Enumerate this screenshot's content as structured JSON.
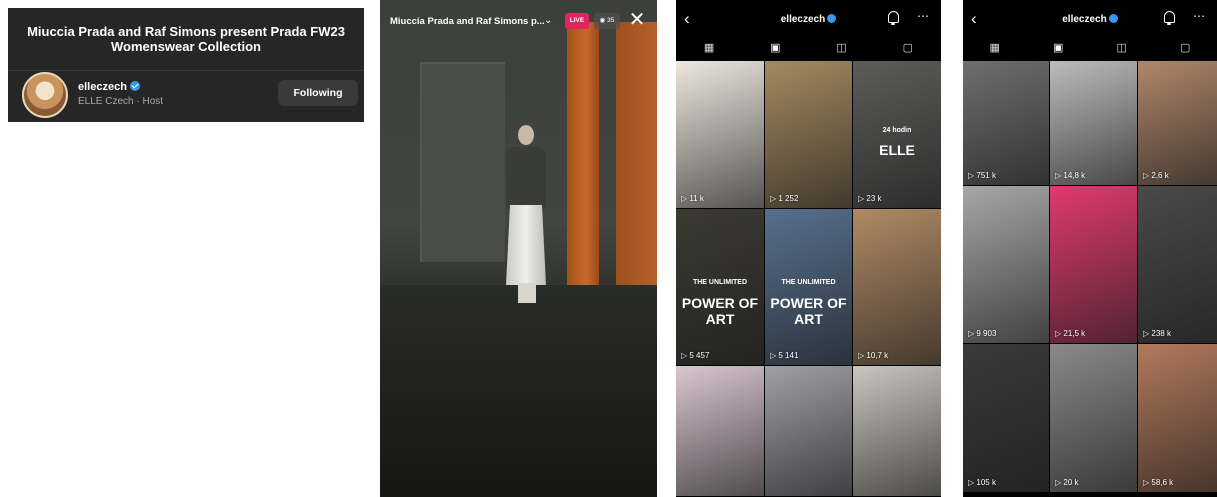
{
  "live_card": {
    "title": "Miuccia Prada and Raf Simons present Prada FW23 Womenswear Collection",
    "host_name": "elleczech",
    "host_sub": "ELLE Czech · Host",
    "follow_label": "Following"
  },
  "live_video": {
    "title": "Miuccia Prada and Raf Simons p...",
    "badge": "LIVE",
    "viewers": "35",
    "close_icon": "close-icon"
  },
  "profile_a": {
    "username": "elleczech",
    "tiles": [
      {
        "views": "11 k",
        "bg": "#ede7de"
      },
      {
        "views": "1 252",
        "bg": "#a58a5f"
      },
      {
        "views": "23 k",
        "bg": "#5c5d5a",
        "overlay_top": "24 hodin",
        "overlay_bottom": "ELLE"
      },
      {
        "views": "5 457",
        "bg": "#3b3a33",
        "overlay_top": "THE UNLIMITED",
        "overlay_bottom": "POWER OF ART"
      },
      {
        "views": "5 141",
        "bg": "#57708e",
        "overlay_top": "THE UNLIMITED",
        "overlay_bottom": "POWER OF ART"
      },
      {
        "views": "10,7 k",
        "bg": "#b08a64"
      },
      {
        "views": "",
        "bg": "#d9c6cf"
      },
      {
        "views": "",
        "bg": "#9f9fa6"
      },
      {
        "views": "",
        "bg": "#c9c6c0"
      }
    ]
  },
  "profile_b": {
    "username": "elleczech",
    "tiles": [
      {
        "views": "751 k",
        "bg": "#6f6f6f"
      },
      {
        "views": "14,8 k",
        "bg": "#bcbcbc"
      },
      {
        "views": "2,6 k",
        "bg": "#b0876a"
      },
      {
        "views": "9 903",
        "bg": "#a7a7a7"
      },
      {
        "views": "21,5 k",
        "bg": "#e03a6f"
      },
      {
        "views": "238 k",
        "bg": "#4a4a4a"
      },
      {
        "views": "105 k",
        "bg": "#3a3a3a"
      },
      {
        "views": "20 k",
        "bg": "#8a8a8a"
      },
      {
        "views": "58,6 k",
        "bg": "#b37a5c"
      }
    ]
  }
}
